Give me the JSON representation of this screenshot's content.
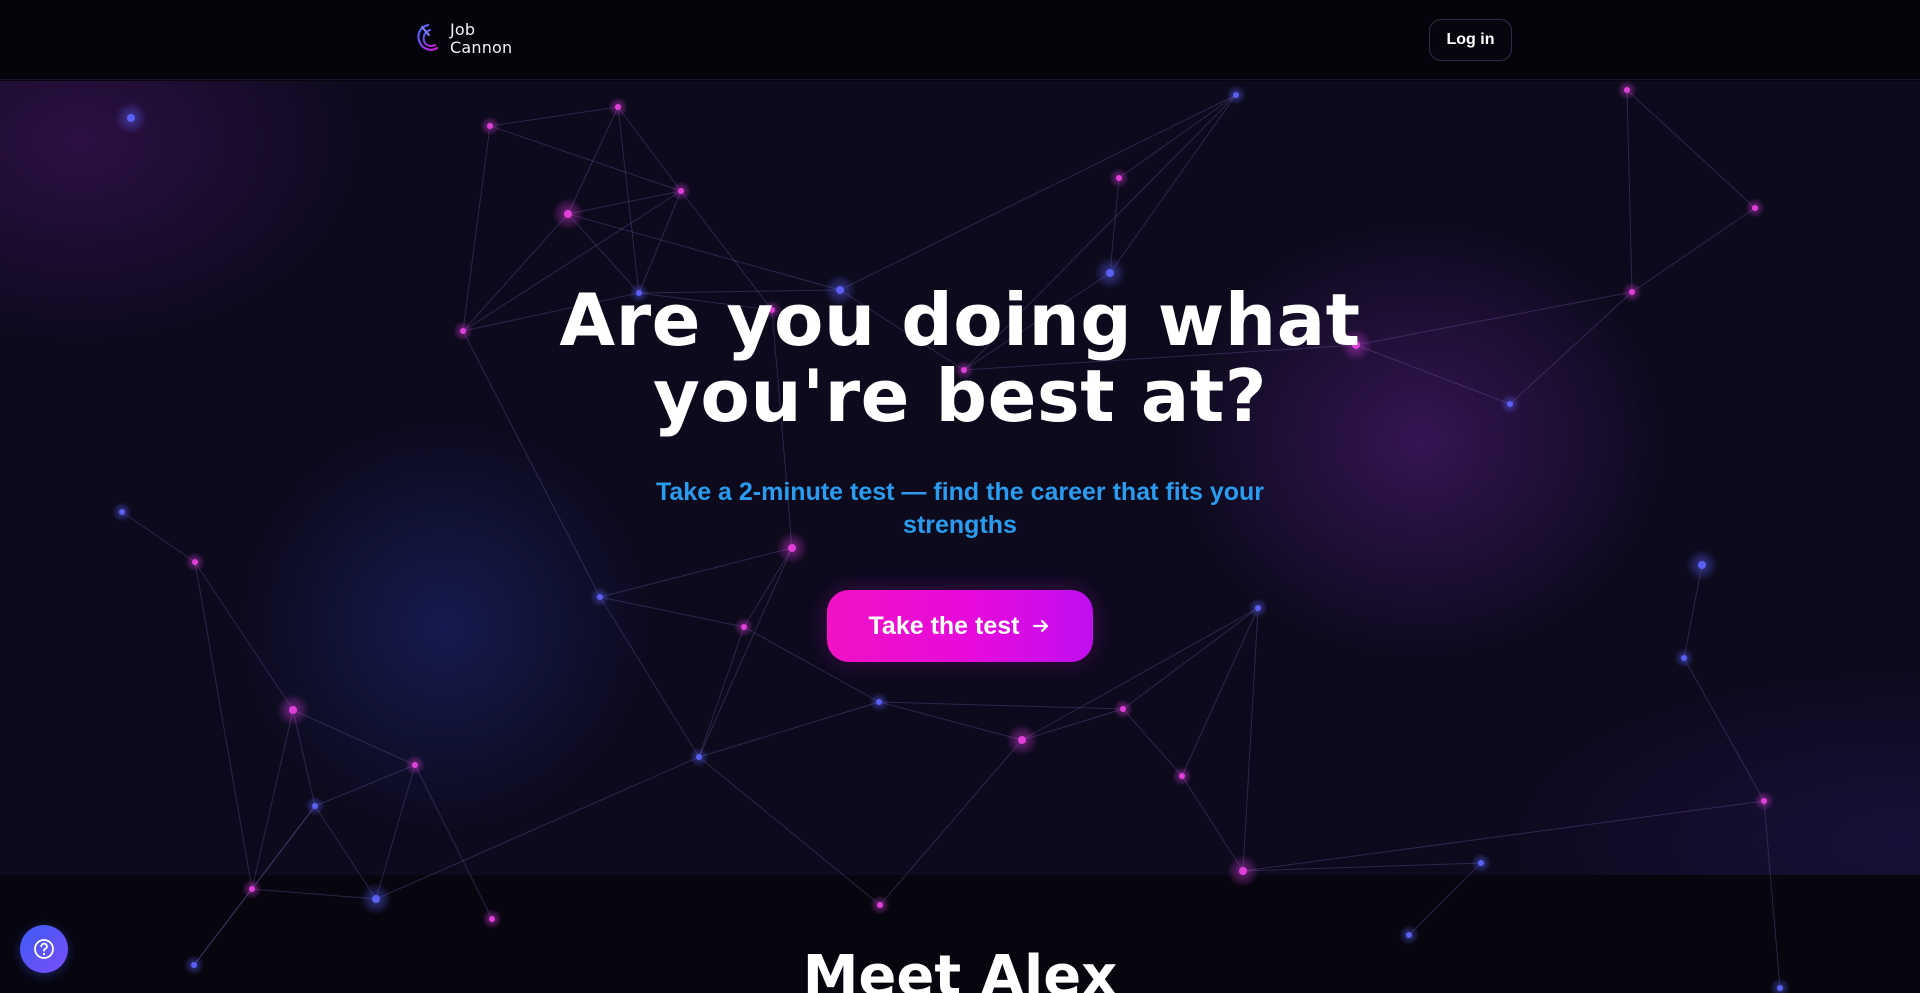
{
  "header": {
    "logo_line1": "Job",
    "logo_line2": "Cannon",
    "login_label": "Log in"
  },
  "hero": {
    "title_line1": "Are you doing what",
    "title_line2": "you're best at?",
    "subtitle": "Take a 2-minute test — find the career that fits your strengths",
    "cta_label": "Take the test"
  },
  "next_section": {
    "title": "Meet Alex"
  },
  "colors": {
    "accent_pink": "#f012c4",
    "accent_purple": "#c00ef0",
    "subtitle_blue": "#2a9cf0",
    "background": "#07060f"
  },
  "icons": {
    "logo": "job-cannon-logo",
    "cta_arrow": "arrow-right-icon",
    "help": "help-circle-icon"
  }
}
